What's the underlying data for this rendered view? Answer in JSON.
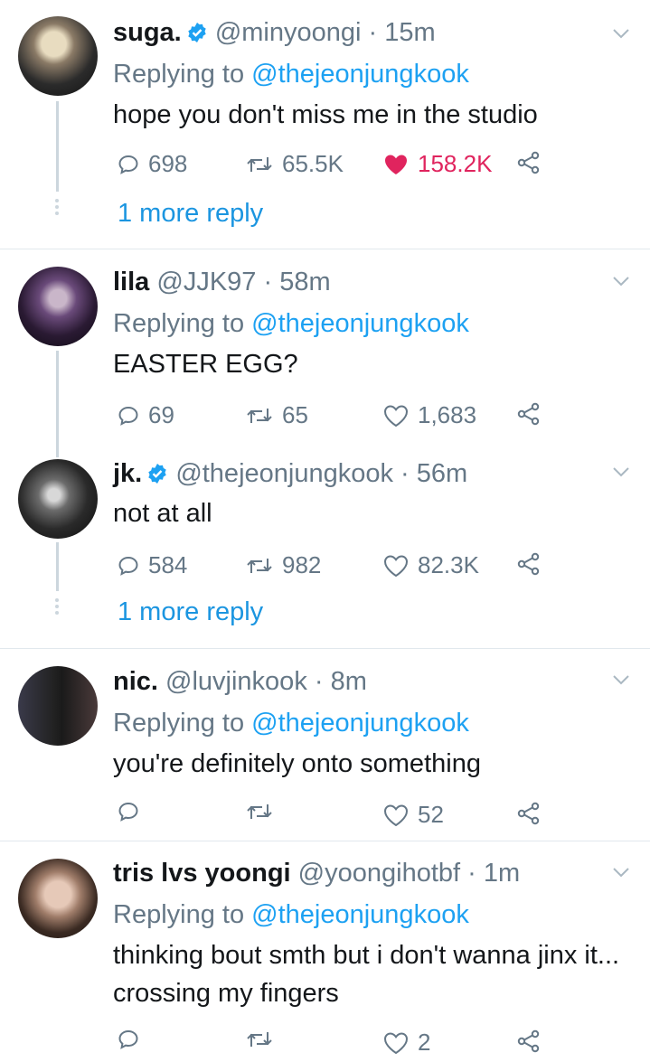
{
  "tweets": [
    {
      "name": "suga.",
      "verified": true,
      "handle": "@minyoongi",
      "time": "· 15m",
      "replying_prefix": "Replying to ",
      "replying_handle": "@thejeonjungkook",
      "text": "hope you don't miss me in the studio",
      "replies": "698",
      "retweets": "65.5K",
      "likes": "158.2K",
      "liked": true,
      "more_reply": "1 more reply"
    },
    {
      "name": "lila",
      "verified": false,
      "handle": "@JJK97",
      "time": "· 58m",
      "replying_prefix": "Replying to ",
      "replying_handle": "@thejeonjungkook",
      "text": "EASTER EGG?",
      "replies": "69",
      "retweets": "65",
      "likes": "1,683",
      "liked": false
    },
    {
      "name": "jk.",
      "verified": true,
      "handle": "@thejeonjungkook",
      "time": "· 56m",
      "text": "not at all",
      "replies": "584",
      "retweets": "982",
      "likes": "82.3K",
      "liked": false,
      "more_reply": "1 more reply"
    },
    {
      "name": "nic.",
      "verified": false,
      "handle": "@luvjinkook",
      "time": "· 8m",
      "replying_prefix": "Replying to ",
      "replying_handle": "@thejeonjungkook",
      "text": "you're definitely onto something",
      "replies": "",
      "retweets": "",
      "likes": "52",
      "liked": false
    },
    {
      "name": "tris lvs yoongi",
      "verified": false,
      "handle": "@yoongihotbf",
      "time": "· 1m",
      "replying_prefix": "Replying to ",
      "replying_handle": "@thejeonjungkook",
      "text": "thinking bout smth but i don't wanna jinx it... crossing my fingers",
      "replies": "",
      "retweets": "",
      "likes": "2",
      "liked": false
    }
  ],
  "colors": {
    "accent": "#1da1f2",
    "like": "#e0245e",
    "muted": "#657786"
  },
  "icons": [
    "reply-icon",
    "retweet-icon",
    "heart-icon",
    "share-icon",
    "chevron-down-icon",
    "verified-badge-icon"
  ]
}
